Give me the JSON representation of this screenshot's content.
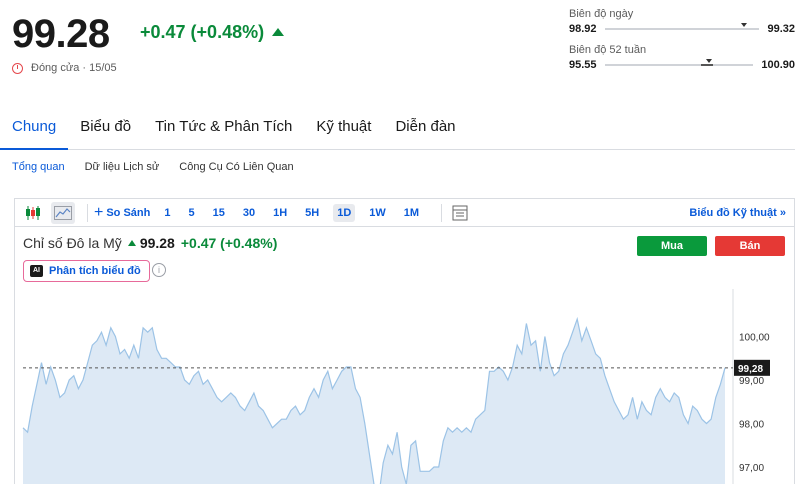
{
  "quote": {
    "price": "99.28",
    "change": "+0.47 (+0.48%)",
    "status": "Đóng cửa · 15/05"
  },
  "day_range": {
    "label": "Biên độ ngày",
    "low": "98.92",
    "high": "99.32",
    "position": 0.9
  },
  "week52_range": {
    "label": "Biên độ 52 tuần",
    "low": "95.55",
    "high": "100.90",
    "position": 0.7
  },
  "tabs": [
    {
      "label": "Chung",
      "active": true
    },
    {
      "label": "Biểu đồ",
      "active": false
    },
    {
      "label": "Tin Tức & Phân Tích",
      "active": false
    },
    {
      "label": "Kỹ thuật",
      "active": false
    },
    {
      "label": "Diễn đàn",
      "active": false
    }
  ],
  "subtabs": [
    {
      "label": "Tổng quan",
      "active": true
    },
    {
      "label": "Dữ liệu Lịch sử",
      "active": false
    },
    {
      "label": "Công Cụ Có Liên Quan",
      "active": false
    }
  ],
  "toolbar": {
    "compare_label": "So Sánh",
    "timeframes": [
      "1",
      "5",
      "15",
      "30",
      "1H",
      "5H",
      "1D",
      "1W",
      "1M"
    ],
    "active_timeframe": "1D",
    "advanced_label": "Biểu đồ Kỹ thuật",
    "advanced_arrow": "»"
  },
  "panel": {
    "instrument": "Chỉ số Đô la Mỹ",
    "price": "99.28",
    "change": "+0.47 (+0.48%)",
    "ai_label": "Phân tích biểu đồ",
    "ai_badge": "AI",
    "info": "i",
    "buy_label": "Mua",
    "sell_label": "Bán"
  },
  "colors": {
    "up": "#0a8a3a",
    "accent": "#0a5ad8",
    "buy": "#0a9a3c",
    "sell": "#e53935",
    "line": "#9cc3e6",
    "area": "#dde9f5"
  },
  "chart_data": {
    "type": "area",
    "y_ticks": [
      "100,00",
      "99,00",
      "98,00",
      "97,00"
    ],
    "y_tick_values": [
      100,
      99,
      98,
      97
    ],
    "current_label": "99,28",
    "current_value": 99.28,
    "ylim": [
      96.6,
      101.0
    ],
    "values": [
      97.9,
      97.8,
      98.4,
      98.9,
      99.4,
      98.9,
      99.3,
      99.0,
      98.6,
      98.7,
      99.0,
      99.1,
      98.8,
      99.0,
      99.4,
      99.8,
      99.9,
      100.1,
      99.8,
      100.2,
      100.0,
      99.6,
      99.7,
      99.5,
      99.8,
      99.5,
      100.2,
      100.1,
      100.2,
      99.7,
      99.5,
      99.5,
      99.4,
      99.3,
      99.3,
      99.0,
      98.9,
      99.1,
      99.2,
      98.9,
      99.0,
      98.8,
      98.6,
      98.5,
      98.6,
      98.7,
      98.6,
      98.4,
      98.3,
      98.5,
      98.7,
      98.4,
      98.3,
      98.1,
      97.9,
      98.0,
      98.1,
      98.1,
      98.3,
      98.4,
      98.2,
      98.3,
      98.6,
      98.8,
      98.6,
      99.0,
      99.2,
      98.8,
      99.0,
      99.2,
      99.3,
      99.3,
      98.8,
      98.6,
      98.0,
      97.3,
      96.6,
      96.3,
      97.1,
      97.5,
      97.3,
      97.8,
      97.0,
      96.6,
      97.5,
      97.6,
      96.9,
      96.9,
      96.9,
      97.0,
      97.0,
      97.6,
      97.9,
      97.8,
      97.9,
      97.8,
      97.9,
      97.8,
      98.1,
      98.2,
      98.3,
      99.2,
      99.2,
      99.3,
      99.2,
      99.0,
      99.3,
      99.8,
      99.6,
      100.3,
      99.8,
      99.9,
      99.2,
      100.0,
      99.4,
      99.1,
      99.2,
      99.6,
      99.8,
      100.1,
      100.4,
      99.9,
      100.2,
      99.9,
      99.6,
      99.5,
      99.1,
      98.8,
      98.5,
      98.3,
      98.1,
      98.2,
      98.6,
      98.1,
      98.5,
      98.3,
      98.2,
      98.6,
      98.8,
      98.6,
      98.5,
      98.7,
      98.6,
      98.2,
      98.0,
      98.4,
      98.3,
      98.1,
      98.0,
      98.1,
      98.6,
      98.9,
      99.28
    ]
  }
}
